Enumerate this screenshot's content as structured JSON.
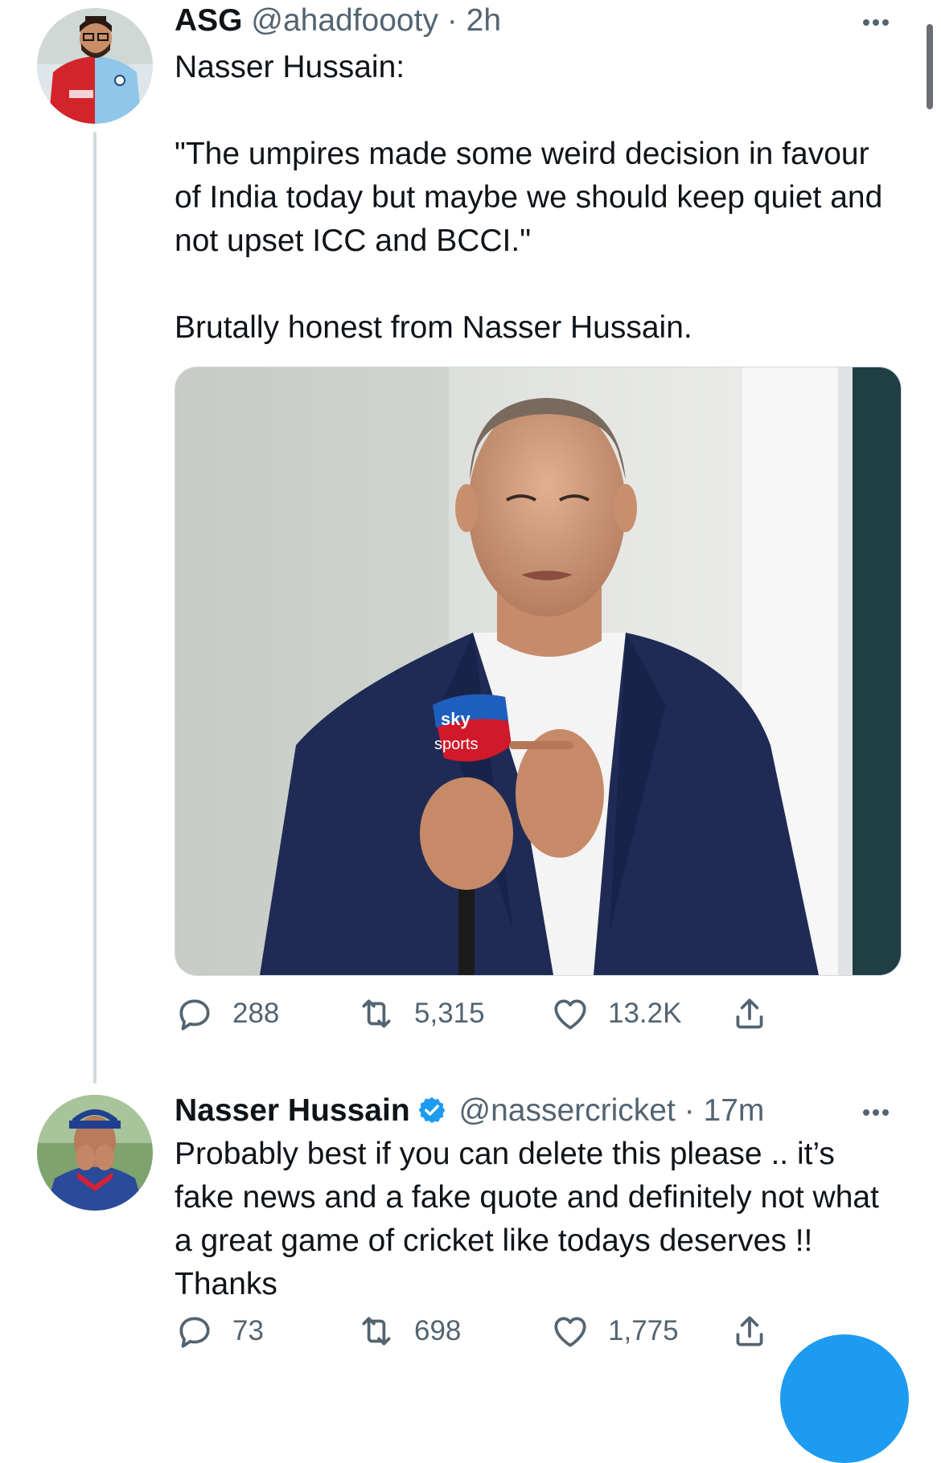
{
  "tweet1": {
    "name": "ASG",
    "handle": "@ahadfoooty",
    "separator": "·",
    "time": "2h",
    "text_lines": [
      "Nasser Hussain:",
      "",
      "\"The umpires made some weird decision in favour of India today but maybe we should keep quiet and not upset ICC and BCCI.\"",
      "",
      "Brutally honest from Nasser Hussain."
    ],
    "media_mic_text": "sky sports",
    "reply_count": "288",
    "retweet_count": "5,315",
    "like_count": "13.2K"
  },
  "tweet2": {
    "name": "Nasser Hussain",
    "handle": "@nassercricket",
    "separator": "·",
    "time": "17m",
    "text": "Probably best if you can delete this please .. it’s fake news and a fake quote and definitely not what a great game of cricket like todays deserves !! Thanks",
    "reply_count": "73",
    "retweet_count": "698",
    "like_count": "1,775"
  },
  "icons": {
    "reply": "reply-icon",
    "retweet": "retweet-icon",
    "like": "heart-icon",
    "share": "share-icon",
    "more": "more-icon",
    "verified": "verified-badge-icon"
  },
  "colors": {
    "text": "#0f1419",
    "secondary": "#536471",
    "verified": "#1d9bf0",
    "thread_line": "#cfd9de"
  }
}
